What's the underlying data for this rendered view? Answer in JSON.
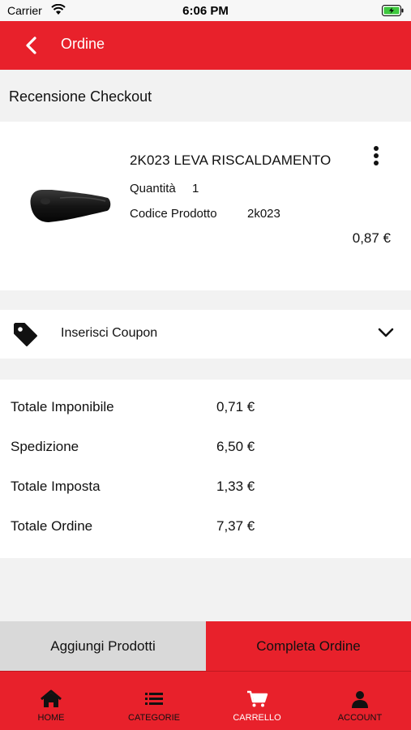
{
  "status_bar": {
    "carrier": "Carrier",
    "time": "6:06 PM"
  },
  "nav": {
    "title": "Ordine",
    "back_icon": "chevron-left-icon"
  },
  "section": {
    "title": "Recensione Checkout"
  },
  "product": {
    "name": "2K023 LEVA RISCALDAMENTO",
    "quantity_label": "Quantità",
    "quantity": "1",
    "code_label": "Codice Prodotto",
    "code": "2k023",
    "price": "0,87 €",
    "menu_icon": "more-vertical-icon"
  },
  "coupon": {
    "label": "Inserisci Coupon",
    "icon": "tag-icon"
  },
  "totals": [
    {
      "label": "Totale Imponibile",
      "value": "0,71 €"
    },
    {
      "label": "Spedizione",
      "value": "6,50 €"
    },
    {
      "label": "Totale Imposta",
      "value": "1,33 €"
    },
    {
      "label": "Totale Ordine",
      "value": "7,37 €"
    }
  ],
  "actions": {
    "add_label": "Aggiungi Prodotti",
    "complete_label": "Completa Ordine"
  },
  "tabs": [
    {
      "label": "HOME",
      "icon": "home-icon"
    },
    {
      "label": "CATEGORIE",
      "icon": "list-icon"
    },
    {
      "label": "CARRELLO",
      "icon": "cart-icon",
      "active": true
    },
    {
      "label": "ACCOUNT",
      "icon": "user-icon"
    }
  ],
  "colors": {
    "brand": "#e8212b",
    "secondary_button": "#d9d9d9",
    "background": "#f2f2f2"
  }
}
